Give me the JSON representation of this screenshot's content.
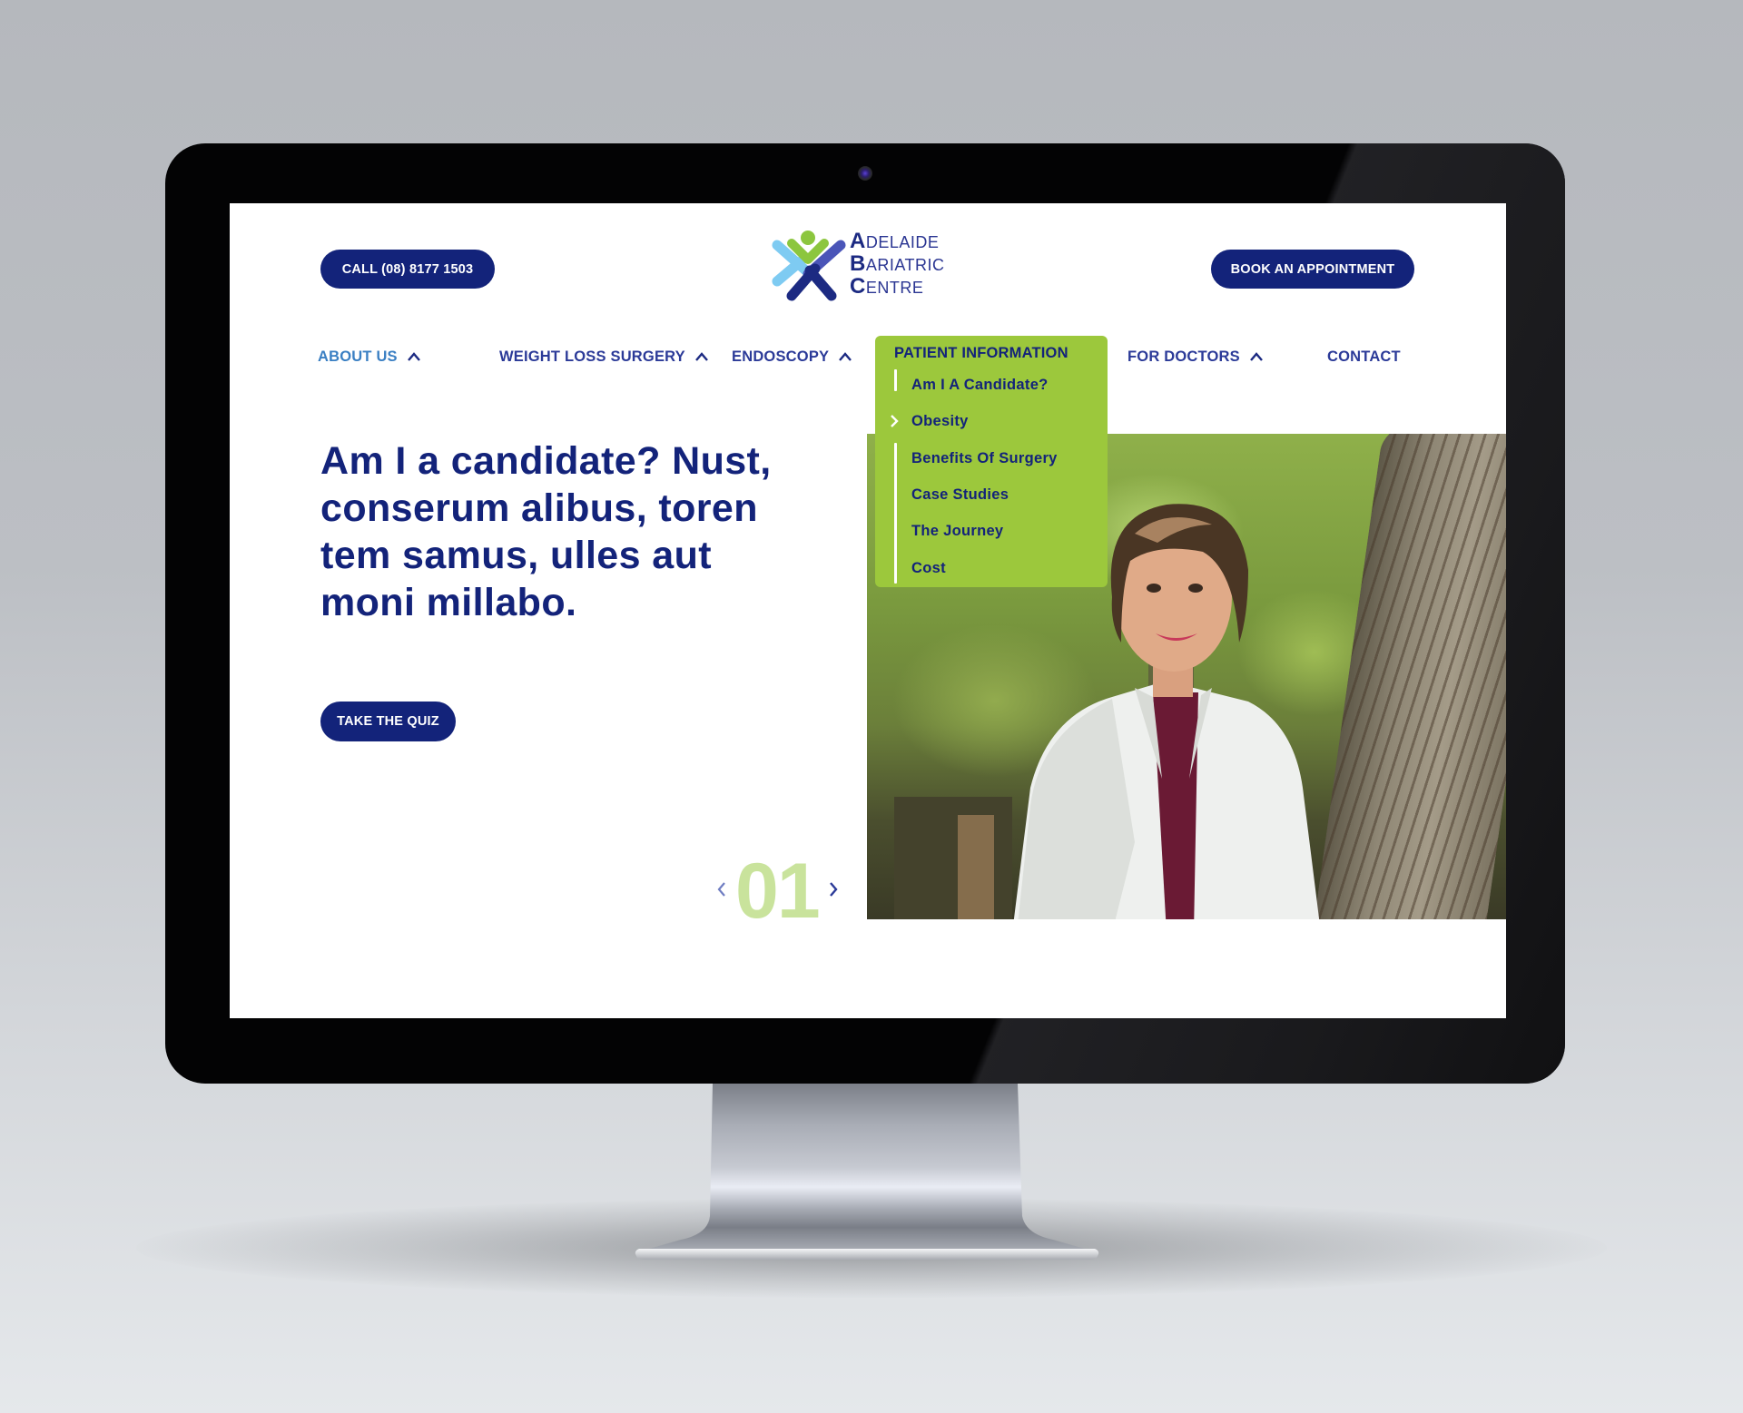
{
  "header": {
    "call_button": "CALL (08) 8177 1503",
    "book_button": "BOOK AN APPOINTMENT",
    "logo": {
      "line1_initial": "A",
      "line1_rest": "DELAIDE",
      "line2_initial": "B",
      "line2_rest": "ARIATRIC",
      "line3_initial": "C",
      "line3_rest": "ENTRE",
      "icon": "person-x-logo-icon"
    }
  },
  "nav": {
    "items": [
      {
        "label": "ABOUT US",
        "icon": "chevron-up-icon"
      },
      {
        "label": "WEIGHT LOSS SURGERY",
        "icon": "chevron-up-icon"
      },
      {
        "label": "ENDOSCOPY",
        "icon": "chevron-up-icon"
      },
      {
        "label": "PATIENT INFORMATION"
      },
      {
        "label": "FOR DOCTORS",
        "icon": "chevron-up-icon"
      },
      {
        "label": "CONTACT"
      }
    ],
    "dropdown": {
      "title": "PATIENT INFORMATION",
      "active_index": 1,
      "items": [
        {
          "label": "Am I A Candidate?"
        },
        {
          "label": "Obesity"
        },
        {
          "label": "Benefits Of Surgery"
        },
        {
          "label": "Case Studies"
        },
        {
          "label": "The Journey"
        },
        {
          "label": "Cost"
        }
      ]
    }
  },
  "hero": {
    "headline": "Am I a candidate? Nust, conserum alibus, toren tem samus, ulles aut moni millabo.",
    "cta_button": "TAKE THE QUIZ",
    "slide_counter": "01",
    "prev_icon": "chevron-left-icon",
    "next_icon": "chevron-right-icon",
    "image": "doctor-in-white-coat-photo"
  },
  "colors": {
    "navy": "#13237a",
    "nav_text": "#2b3a98",
    "nav_active": "#3a7fc3",
    "dropdown_green": "#9cc83c",
    "counter_green": "#c9e39c"
  }
}
